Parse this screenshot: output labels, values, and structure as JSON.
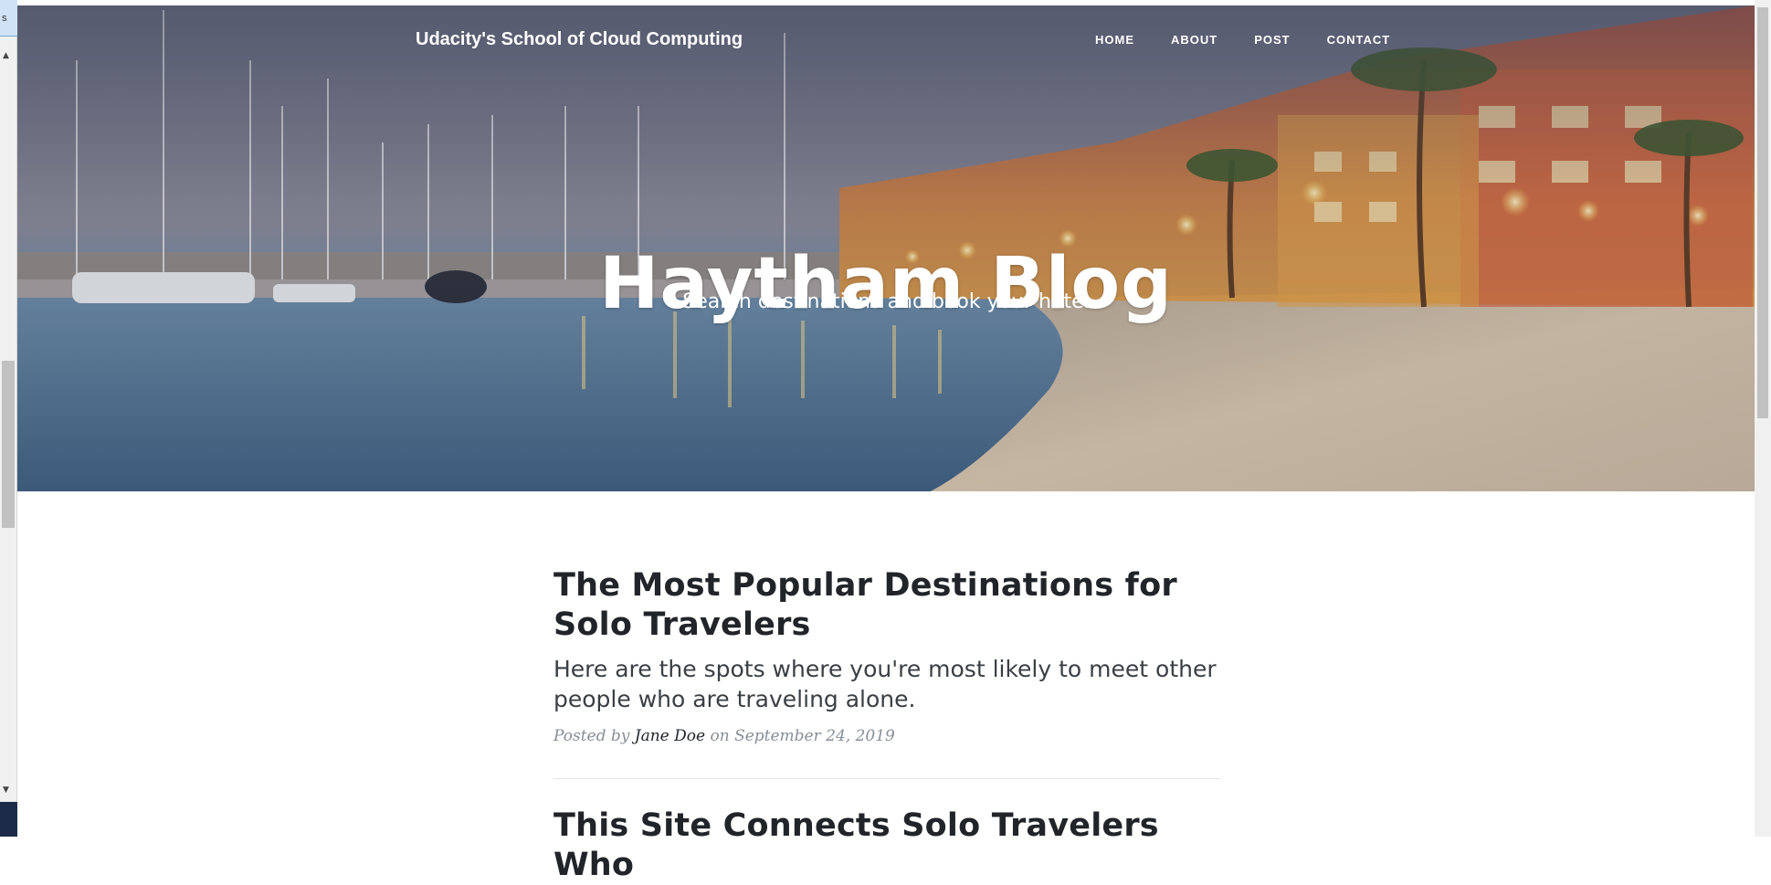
{
  "nav": {
    "brand": "Udacity's School of Cloud Computing",
    "links": [
      "HOME",
      "ABOUT",
      "POST",
      "CONTACT"
    ]
  },
  "hero": {
    "title": "Haytham Blog",
    "subtitle": "Search destinations and book your hotel"
  },
  "posts": [
    {
      "title": "The Most Popular Destinations for Solo Travelers",
      "subtitle": "Here are the spots where you're most likely to meet other people who are traveling alone.",
      "meta_prefix": "Posted by",
      "author": "Jane Doe",
      "meta_on": "on",
      "date": "September 24, 2019"
    },
    {
      "title": "This Site Connects Solo Travelers Who"
    }
  ],
  "ui": {
    "left_tab_char": "s",
    "scroll_up": "▲",
    "scroll_down": "▼"
  },
  "colors": {
    "text_dark": "#212529",
    "meta_gray": "#868e96",
    "white": "#ffffff"
  }
}
